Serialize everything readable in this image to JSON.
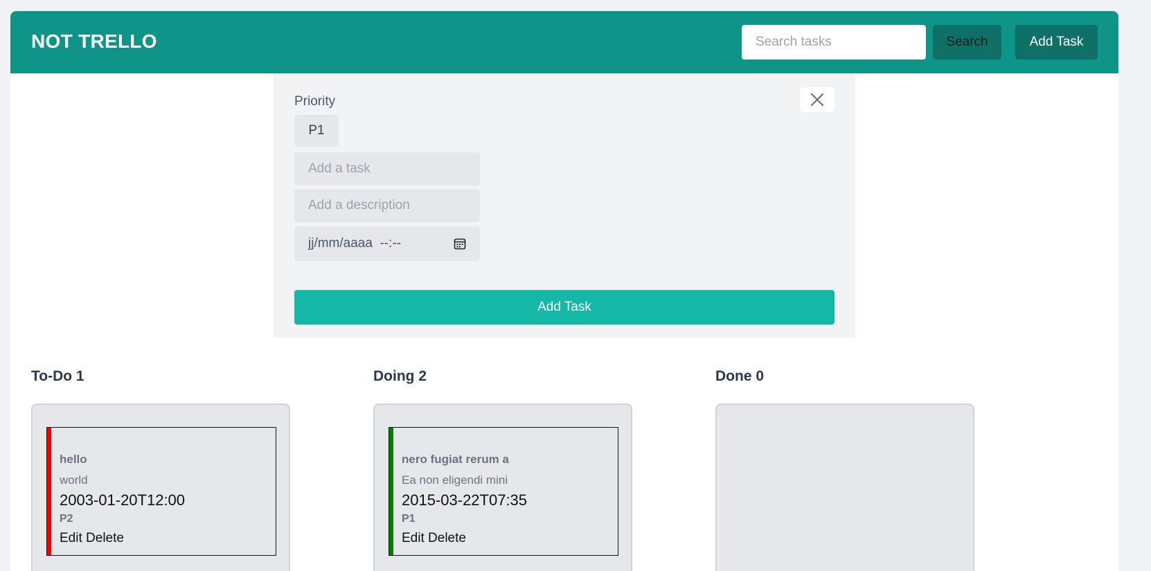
{
  "header": {
    "brand": "NOT TRELLO",
    "search_placeholder": "Search tasks",
    "search_label": "Search",
    "add_task_label": "Add Task"
  },
  "form": {
    "priority_label": "Priority",
    "priority_value": "P1",
    "task_placeholder": "Add a task",
    "description_placeholder": "Add a description",
    "date_placeholder": "jj/mm/aaaa  --:--",
    "submit_label": "Add Task",
    "close_icon": "close-icon",
    "calendar_icon": "calendar-icon"
  },
  "columns": [
    {
      "title": "To-Do 1",
      "cards": [
        {
          "title": "hello",
          "description": "world",
          "date": "2003-01-20T12:00",
          "priority": "P2",
          "stripe_color": "#ef0000",
          "edit_label": "Edit",
          "delete_label": "Delete"
        }
      ]
    },
    {
      "title": "Doing 2",
      "cards": [
        {
          "title": "nero fugiat rerum a",
          "description": "Ea non eligendi mini",
          "date": "2015-03-22T07:35",
          "priority": "P1",
          "stripe_color": "#008000",
          "edit_label": "Edit",
          "delete_label": "Delete"
        },
        {
          "stripe_color": "#ffe000"
        }
      ]
    },
    {
      "title": "Done 0",
      "cards": []
    }
  ],
  "colors": {
    "header_bg": "#0e9488",
    "button_dark": "#0f7068",
    "submit_bg": "#14b8a6"
  }
}
